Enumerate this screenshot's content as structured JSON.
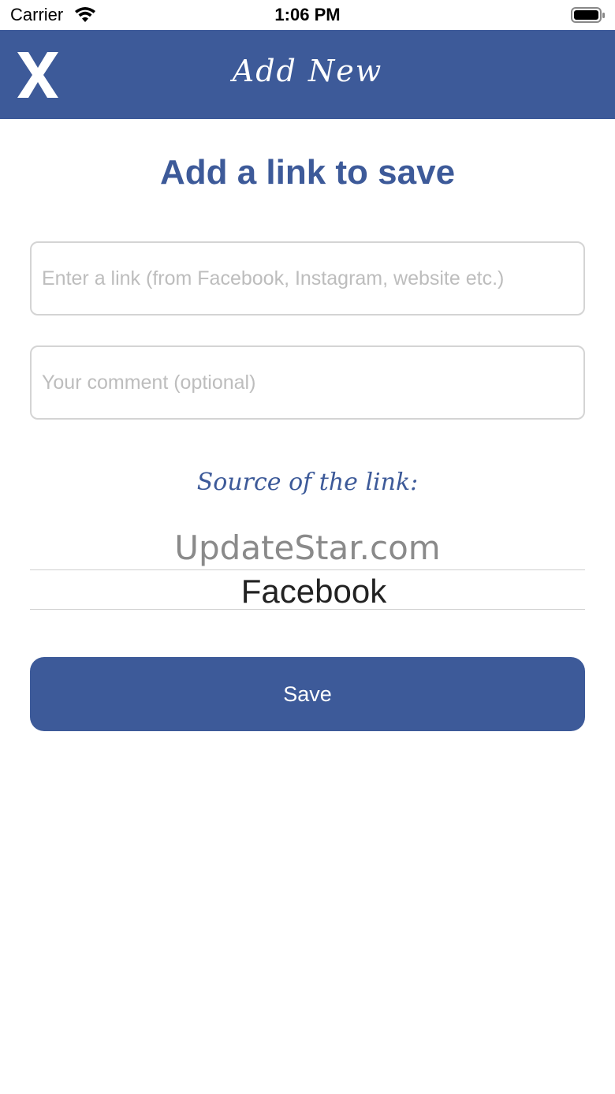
{
  "status_bar": {
    "carrier": "Carrier",
    "time": "1:06 PM"
  },
  "nav": {
    "title": "Add New",
    "close_label": "X",
    "color": "#3d5a99"
  },
  "main": {
    "heading": "Add a link to save",
    "link_field": {
      "value": "",
      "placeholder": "Enter a link (from Facebook, Instagram, website etc.)"
    },
    "comment_field": {
      "value": "",
      "placeholder": "Your comment (optional)"
    },
    "source_label": "Source of the link:",
    "source_picker": {
      "options_visible": [
        "UpdateStar.com",
        "Facebook"
      ],
      "selected": "Facebook"
    },
    "save_label": "Save"
  },
  "icons": {
    "close": "close-icon",
    "wifi": "wifi-icon",
    "battery": "battery-icon"
  }
}
